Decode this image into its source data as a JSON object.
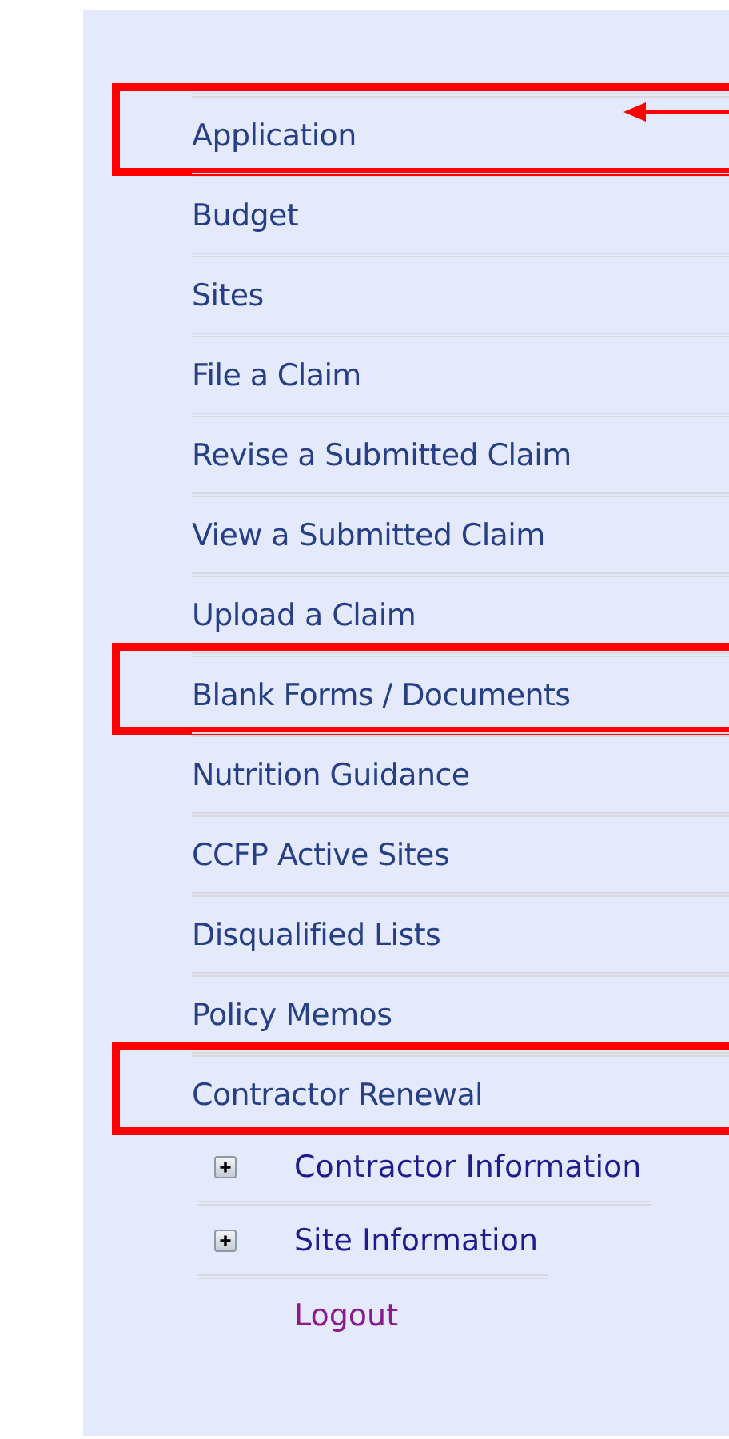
{
  "menu": {
    "items": [
      {
        "label": "Application",
        "highlighted": true,
        "arrow": true
      },
      {
        "label": "Budget",
        "highlighted": false,
        "arrow": false
      },
      {
        "label": "Sites",
        "highlighted": false,
        "arrow": false
      },
      {
        "label": "File a Claim",
        "highlighted": false,
        "arrow": false
      },
      {
        "label": "Revise a Submitted Claim",
        "highlighted": false,
        "arrow": false
      },
      {
        "label": "View a Submitted Claim",
        "highlighted": false,
        "arrow": false
      },
      {
        "label": "Upload a Claim",
        "highlighted": false,
        "arrow": false
      },
      {
        "label": "Blank Forms / Documents",
        "highlighted": true,
        "arrow": false
      },
      {
        "label": "Nutrition Guidance",
        "highlighted": false,
        "arrow": false
      },
      {
        "label": "CCFP Active Sites",
        "highlighted": false,
        "arrow": false
      },
      {
        "label": "Disqualified Lists",
        "highlighted": false,
        "arrow": false
      },
      {
        "label": "Policy Memos",
        "highlighted": false,
        "arrow": false
      },
      {
        "label": "Contractor Renewal",
        "highlighted": true,
        "arrow": false,
        "children": [
          {
            "label": "Contractor Information",
            "expanded": false
          },
          {
            "label": "Site Information",
            "expanded": false
          }
        ]
      }
    ],
    "logout": "Logout"
  }
}
